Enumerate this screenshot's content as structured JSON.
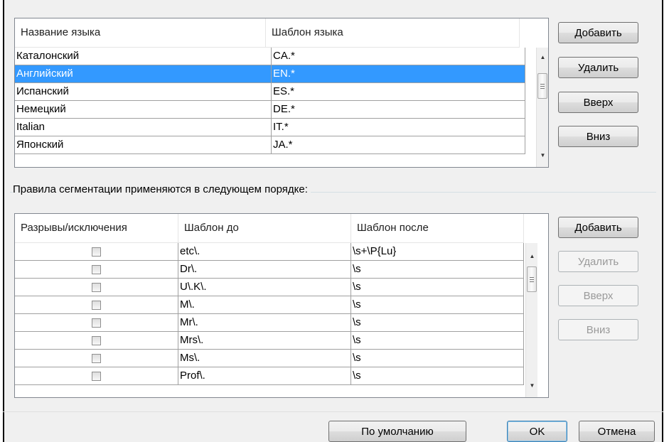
{
  "languages": {
    "headers": [
      "Название языка",
      "Шаблон языка"
    ],
    "rows": [
      {
        "name": "Каталонский",
        "pattern": "CA.*"
      },
      {
        "name": "Английский",
        "pattern": "EN.*"
      },
      {
        "name": "Испанский",
        "pattern": "ES.*"
      },
      {
        "name": "Немецкий",
        "pattern": "DE.*"
      },
      {
        "name": "Italian",
        "pattern": "IT.*"
      },
      {
        "name": "Японский",
        "pattern": "JA.*"
      }
    ],
    "selected_index": 1,
    "buttons": {
      "add": "Добавить",
      "remove": "Удалить",
      "up": "Вверх",
      "down": "Вниз"
    }
  },
  "rules_group_label": "Правила сегментации применяются в следующем порядке:",
  "rules": {
    "headers": [
      "Разрывы/исключения",
      "Шаблон до",
      "Шаблон после"
    ],
    "rows": [
      {
        "checked": false,
        "before": "etc\\.",
        "after": "\\s+\\P{Lu}"
      },
      {
        "checked": false,
        "before": "Dr\\.",
        "after": "\\s"
      },
      {
        "checked": false,
        "before": "U\\.K\\.",
        "after": "\\s"
      },
      {
        "checked": false,
        "before": "M\\.",
        "after": "\\s"
      },
      {
        "checked": false,
        "before": "Mr\\.",
        "after": "\\s"
      },
      {
        "checked": false,
        "before": "Mrs\\.",
        "after": "\\s"
      },
      {
        "checked": false,
        "before": "Ms\\.",
        "after": "\\s"
      },
      {
        "checked": false,
        "before": "Prof\\.",
        "after": "\\s"
      }
    ],
    "buttons": {
      "add": "Добавить",
      "remove": "Удалить",
      "up": "Вверх",
      "down": "Вниз"
    }
  },
  "footer": {
    "defaults": "По умолчанию",
    "ok": "OK",
    "cancel": "Отмена"
  },
  "colors": {
    "selection": "#3399ff",
    "dialog_bg": "#f0f0f0"
  }
}
